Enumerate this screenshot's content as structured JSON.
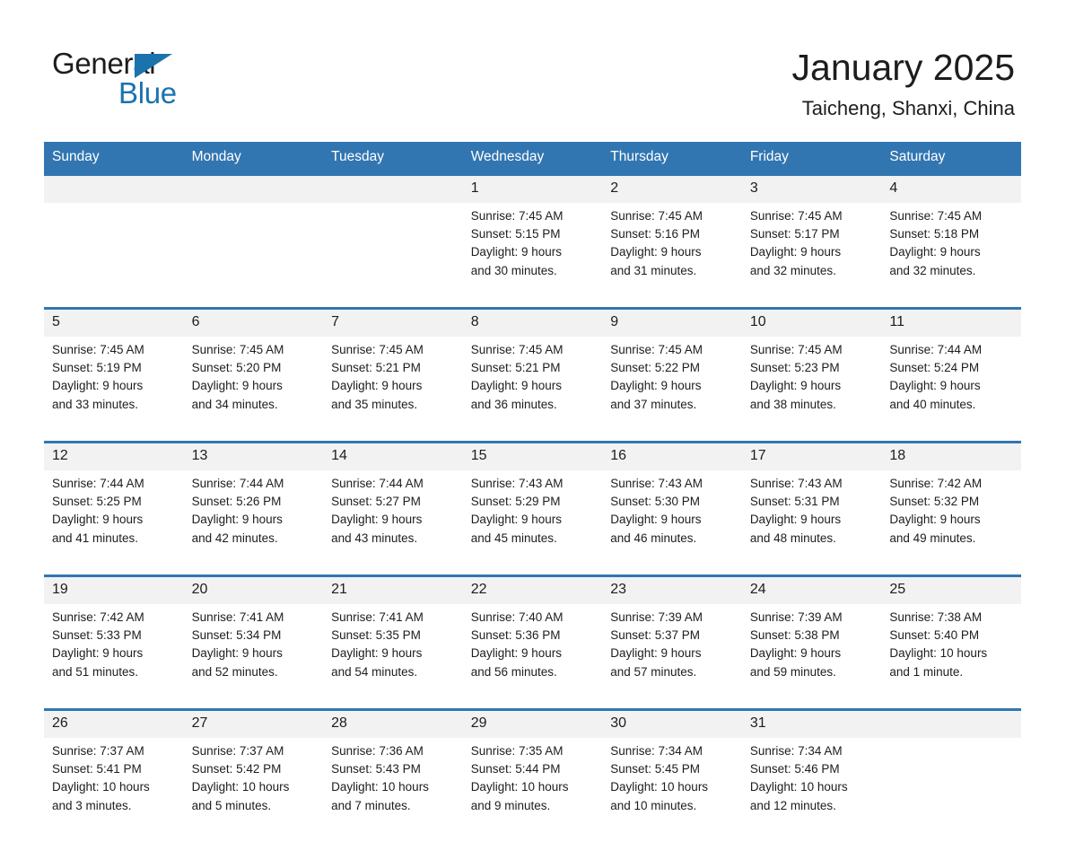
{
  "logo": {
    "word1": "General",
    "word2": "Blue",
    "triangle_color": "#1a73ad"
  },
  "header": {
    "title": "January 2025",
    "location": "Taicheng, Shanxi, China"
  },
  "colors": {
    "header_blue": "#3276b1",
    "daynum_bg": "#f2f2f2",
    "text": "#1d1d1d"
  },
  "calendar": {
    "weekday_headers": [
      "Sunday",
      "Monday",
      "Tuesday",
      "Wednesday",
      "Thursday",
      "Friday",
      "Saturday"
    ],
    "weeks": [
      [
        {
          "day": "",
          "lines": []
        },
        {
          "day": "",
          "lines": []
        },
        {
          "day": "",
          "lines": []
        },
        {
          "day": "1",
          "lines": [
            "Sunrise: 7:45 AM",
            "Sunset: 5:15 PM",
            "Daylight: 9 hours",
            "and 30 minutes."
          ]
        },
        {
          "day": "2",
          "lines": [
            "Sunrise: 7:45 AM",
            "Sunset: 5:16 PM",
            "Daylight: 9 hours",
            "and 31 minutes."
          ]
        },
        {
          "day": "3",
          "lines": [
            "Sunrise: 7:45 AM",
            "Sunset: 5:17 PM",
            "Daylight: 9 hours",
            "and 32 minutes."
          ]
        },
        {
          "day": "4",
          "lines": [
            "Sunrise: 7:45 AM",
            "Sunset: 5:18 PM",
            "Daylight: 9 hours",
            "and 32 minutes."
          ]
        }
      ],
      [
        {
          "day": "5",
          "lines": [
            "Sunrise: 7:45 AM",
            "Sunset: 5:19 PM",
            "Daylight: 9 hours",
            "and 33 minutes."
          ]
        },
        {
          "day": "6",
          "lines": [
            "Sunrise: 7:45 AM",
            "Sunset: 5:20 PM",
            "Daylight: 9 hours",
            "and 34 minutes."
          ]
        },
        {
          "day": "7",
          "lines": [
            "Sunrise: 7:45 AM",
            "Sunset: 5:21 PM",
            "Daylight: 9 hours",
            "and 35 minutes."
          ]
        },
        {
          "day": "8",
          "lines": [
            "Sunrise: 7:45 AM",
            "Sunset: 5:21 PM",
            "Daylight: 9 hours",
            "and 36 minutes."
          ]
        },
        {
          "day": "9",
          "lines": [
            "Sunrise: 7:45 AM",
            "Sunset: 5:22 PM",
            "Daylight: 9 hours",
            "and 37 minutes."
          ]
        },
        {
          "day": "10",
          "lines": [
            "Sunrise: 7:45 AM",
            "Sunset: 5:23 PM",
            "Daylight: 9 hours",
            "and 38 minutes."
          ]
        },
        {
          "day": "11",
          "lines": [
            "Sunrise: 7:44 AM",
            "Sunset: 5:24 PM",
            "Daylight: 9 hours",
            "and 40 minutes."
          ]
        }
      ],
      [
        {
          "day": "12",
          "lines": [
            "Sunrise: 7:44 AM",
            "Sunset: 5:25 PM",
            "Daylight: 9 hours",
            "and 41 minutes."
          ]
        },
        {
          "day": "13",
          "lines": [
            "Sunrise: 7:44 AM",
            "Sunset: 5:26 PM",
            "Daylight: 9 hours",
            "and 42 minutes."
          ]
        },
        {
          "day": "14",
          "lines": [
            "Sunrise: 7:44 AM",
            "Sunset: 5:27 PM",
            "Daylight: 9 hours",
            "and 43 minutes."
          ]
        },
        {
          "day": "15",
          "lines": [
            "Sunrise: 7:43 AM",
            "Sunset: 5:29 PM",
            "Daylight: 9 hours",
            "and 45 minutes."
          ]
        },
        {
          "day": "16",
          "lines": [
            "Sunrise: 7:43 AM",
            "Sunset: 5:30 PM",
            "Daylight: 9 hours",
            "and 46 minutes."
          ]
        },
        {
          "day": "17",
          "lines": [
            "Sunrise: 7:43 AM",
            "Sunset: 5:31 PM",
            "Daylight: 9 hours",
            "and 48 minutes."
          ]
        },
        {
          "day": "18",
          "lines": [
            "Sunrise: 7:42 AM",
            "Sunset: 5:32 PM",
            "Daylight: 9 hours",
            "and 49 minutes."
          ]
        }
      ],
      [
        {
          "day": "19",
          "lines": [
            "Sunrise: 7:42 AM",
            "Sunset: 5:33 PM",
            "Daylight: 9 hours",
            "and 51 minutes."
          ]
        },
        {
          "day": "20",
          "lines": [
            "Sunrise: 7:41 AM",
            "Sunset: 5:34 PM",
            "Daylight: 9 hours",
            "and 52 minutes."
          ]
        },
        {
          "day": "21",
          "lines": [
            "Sunrise: 7:41 AM",
            "Sunset: 5:35 PM",
            "Daylight: 9 hours",
            "and 54 minutes."
          ]
        },
        {
          "day": "22",
          "lines": [
            "Sunrise: 7:40 AM",
            "Sunset: 5:36 PM",
            "Daylight: 9 hours",
            "and 56 minutes."
          ]
        },
        {
          "day": "23",
          "lines": [
            "Sunrise: 7:39 AM",
            "Sunset: 5:37 PM",
            "Daylight: 9 hours",
            "and 57 minutes."
          ]
        },
        {
          "day": "24",
          "lines": [
            "Sunrise: 7:39 AM",
            "Sunset: 5:38 PM",
            "Daylight: 9 hours",
            "and 59 minutes."
          ]
        },
        {
          "day": "25",
          "lines": [
            "Sunrise: 7:38 AM",
            "Sunset: 5:40 PM",
            "Daylight: 10 hours",
            "and 1 minute."
          ]
        }
      ],
      [
        {
          "day": "26",
          "lines": [
            "Sunrise: 7:37 AM",
            "Sunset: 5:41 PM",
            "Daylight: 10 hours",
            "and 3 minutes."
          ]
        },
        {
          "day": "27",
          "lines": [
            "Sunrise: 7:37 AM",
            "Sunset: 5:42 PM",
            "Daylight: 10 hours",
            "and 5 minutes."
          ]
        },
        {
          "day": "28",
          "lines": [
            "Sunrise: 7:36 AM",
            "Sunset: 5:43 PM",
            "Daylight: 10 hours",
            "and 7 minutes."
          ]
        },
        {
          "day": "29",
          "lines": [
            "Sunrise: 7:35 AM",
            "Sunset: 5:44 PM",
            "Daylight: 10 hours",
            "and 9 minutes."
          ]
        },
        {
          "day": "30",
          "lines": [
            "Sunrise: 7:34 AM",
            "Sunset: 5:45 PM",
            "Daylight: 10 hours",
            "and 10 minutes."
          ]
        },
        {
          "day": "31",
          "lines": [
            "Sunrise: 7:34 AM",
            "Sunset: 5:46 PM",
            "Daylight: 10 hours",
            "and 12 minutes."
          ]
        },
        {
          "day": "",
          "lines": []
        }
      ]
    ]
  }
}
